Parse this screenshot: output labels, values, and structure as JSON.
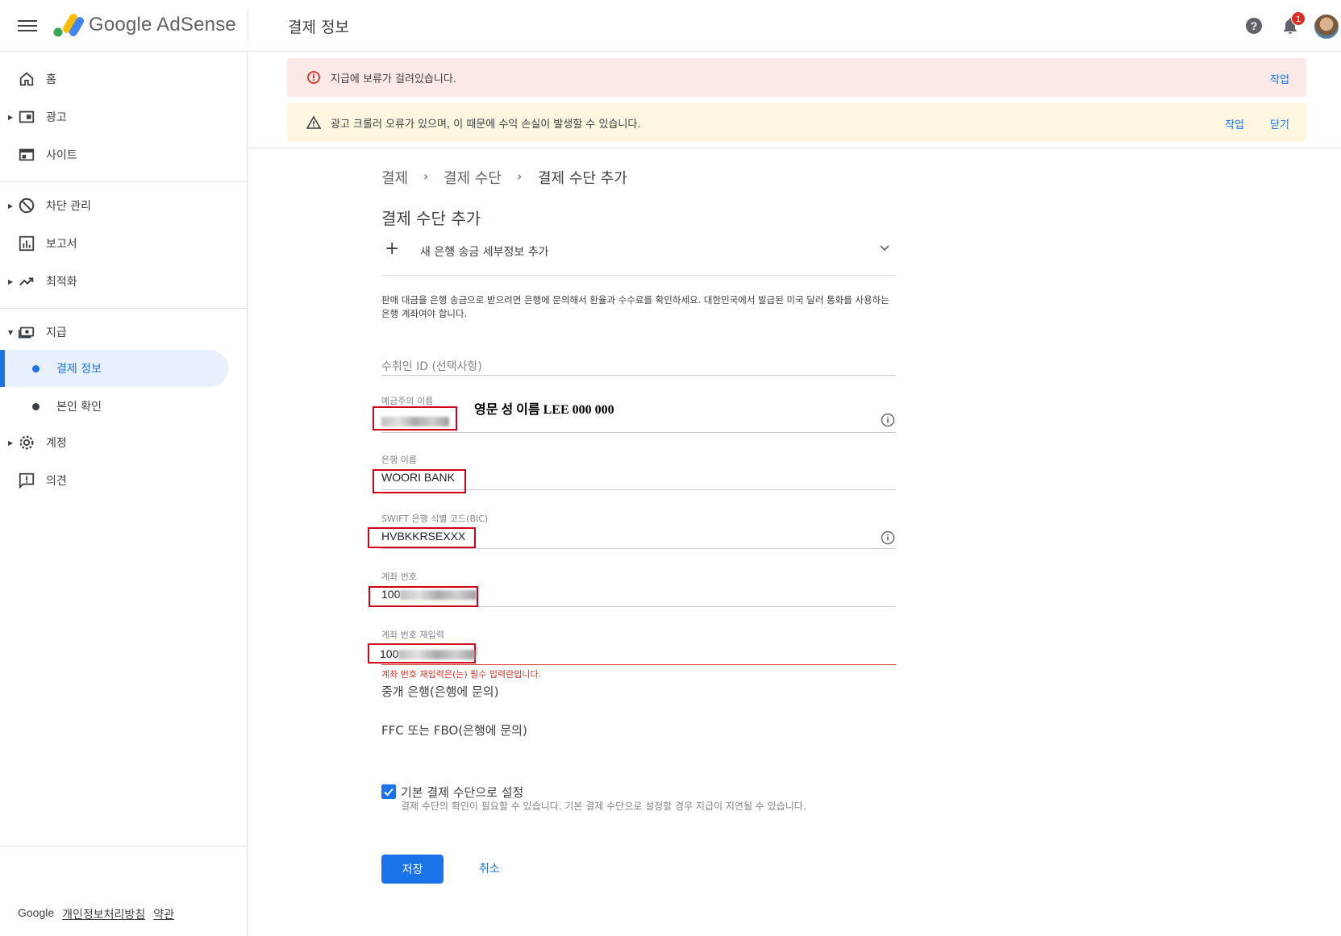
{
  "header": {
    "brand": "Google AdSense",
    "page_title": "결제 정보",
    "notification_count": "1"
  },
  "sidebar": {
    "items": [
      {
        "label": "홈",
        "icon": "home-icon"
      },
      {
        "label": "광고",
        "icon": "ads-icon"
      },
      {
        "label": "사이트",
        "icon": "sites-icon"
      },
      {
        "label": "차단 관리",
        "icon": "block-icon"
      },
      {
        "label": "보고서",
        "icon": "reports-icon"
      },
      {
        "label": "최적화",
        "icon": "trending-icon"
      },
      {
        "label": "지급",
        "icon": "payments-icon"
      },
      {
        "label": "결제 정보"
      },
      {
        "label": "본인 확인"
      },
      {
        "label": "계정",
        "icon": "gear-icon"
      },
      {
        "label": "의견",
        "icon": "feedback-icon"
      }
    ],
    "footer": {
      "google": "Google",
      "privacy": "개인정보처리방침",
      "terms": "약관"
    }
  },
  "alerts": {
    "error": {
      "text": "지급에 보류가 걸려있습니다.",
      "action": "작업"
    },
    "warning": {
      "text": "광고 크롤러 오류가 있으며, 이 때문에 수익 손실이 발생할 수 있습니다.",
      "action": "작업",
      "dismiss": "닫기"
    }
  },
  "breadcrumb": [
    "결제",
    "결제 수단",
    "결제 수단 추가"
  ],
  "form": {
    "title": "결제 수단 추가",
    "add_bank": "새 은행 송금 세부정보 추가",
    "description": "판매 대금을 은행 송금으로 받으려면 은행에 문의해서 환율과 수수료를 확인하세요. 대한민국에서 발급된 미국 달러 통화를 사용하는 은행 계좌여야 합니다.",
    "payee_id_placeholder": "수취인 ID (선택사항)",
    "account_holder_label": "예금주의 이름",
    "annotation": "영문 성 이름 LEE 000 000",
    "bank_name_label": "은행 이름",
    "bank_name_value": "WOORI BANK",
    "swift_label": "SWIFT 은행 식별 코드(BIC)",
    "swift_value": "HVBKKRSEXXX",
    "account_number_label": "계좌 번호",
    "account_number_prefix": "100",
    "account_reenter_label": "계좌 번호 재입력",
    "account_reenter_prefix": "100",
    "error_message": "계좌 번호 재입력은(는) 필수 입력란입니다.",
    "intermediary_bank": "중개 은행(은행에 문의)",
    "ffc_fbo": "FFC 또는 FBO(은행에 문의)",
    "default_checkbox_label": "기본 결제 수단으로 설정",
    "default_checkbox_checked": true,
    "default_checkbox_help": "결제 수단의 확인이 필요할 수 있습니다. 기본 결제 수단으로 설정할 경우 지급이 지연될 수 있습니다.",
    "save": "저장",
    "cancel": "취소"
  },
  "colors": {
    "accent": "#1a73e8",
    "error": "#d93025",
    "annotation_box": "#d0021b"
  }
}
